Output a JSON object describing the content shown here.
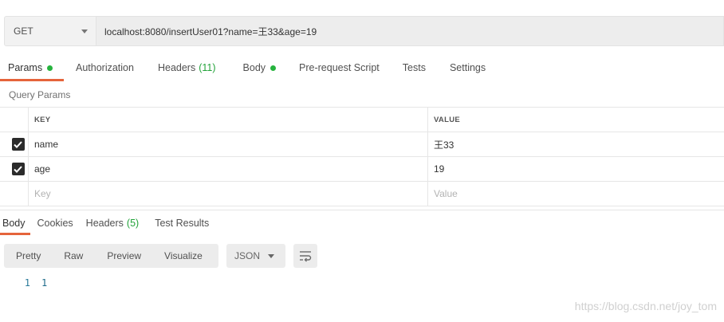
{
  "request": {
    "method": "GET",
    "url": "localhost:8080/insertUser01?name=王33&age=19"
  },
  "tabs": [
    {
      "label": "Params",
      "active": true,
      "dot": true
    },
    {
      "label": "Authorization"
    },
    {
      "label": "Headers",
      "count": "(11)"
    },
    {
      "label": "Body",
      "dot": true
    },
    {
      "label": "Pre-request Script"
    },
    {
      "label": "Tests"
    },
    {
      "label": "Settings"
    }
  ],
  "query_params": {
    "title": "Query Params",
    "headers": {
      "key": "KEY",
      "value": "VALUE"
    },
    "rows": [
      {
        "checked": true,
        "key": "name",
        "value": "王33"
      },
      {
        "checked": true,
        "key": "age",
        "value": "19"
      }
    ],
    "placeholder": {
      "key": "Key",
      "value": "Value"
    }
  },
  "response": {
    "tabs": [
      {
        "label": "Body",
        "active": true
      },
      {
        "label": "Cookies"
      },
      {
        "label": "Headers",
        "count": "(5)"
      },
      {
        "label": "Test Results"
      }
    ],
    "view_modes": [
      "Pretty",
      "Raw",
      "Preview",
      "Visualize"
    ],
    "format": "JSON",
    "lines": [
      {
        "number": "1",
        "text": "1"
      }
    ]
  },
  "watermark": "https://blog.csdn.net/joy_tom",
  "colors": {
    "accent": "#e5643b",
    "status_green": "#26b33e"
  }
}
